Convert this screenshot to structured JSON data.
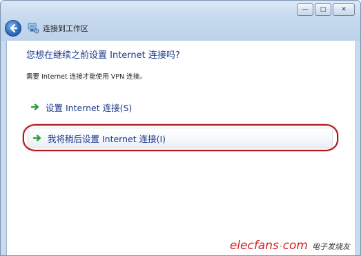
{
  "window": {
    "controls": {
      "minimize": "—",
      "maximize": "□",
      "close": "✕"
    }
  },
  "nav": {
    "back_icon": "back-arrow-icon",
    "network_icon": "network-connection-icon",
    "title": "连接到工作区"
  },
  "main": {
    "heading": "您想在继续之前设置 Internet 连接吗?",
    "description": "需要 Internet 连接才能使用 VPN 连接。",
    "options": [
      {
        "label": "设置 Internet 连接(S)",
        "icon": "green-arrow-icon"
      },
      {
        "label": "我将稍后设置 Internet 连接(I)",
        "icon": "green-arrow-icon",
        "highlighted": true
      }
    ]
  },
  "watermark": {
    "logo": "elecfans",
    "dot": "·",
    "tld": "com",
    "cn": "电子发烧友"
  },
  "colors": {
    "accent": "#1a3a8a",
    "highlight_ring": "#b01818",
    "arrow": "#2a9a3a",
    "watermark": "#d22020"
  }
}
